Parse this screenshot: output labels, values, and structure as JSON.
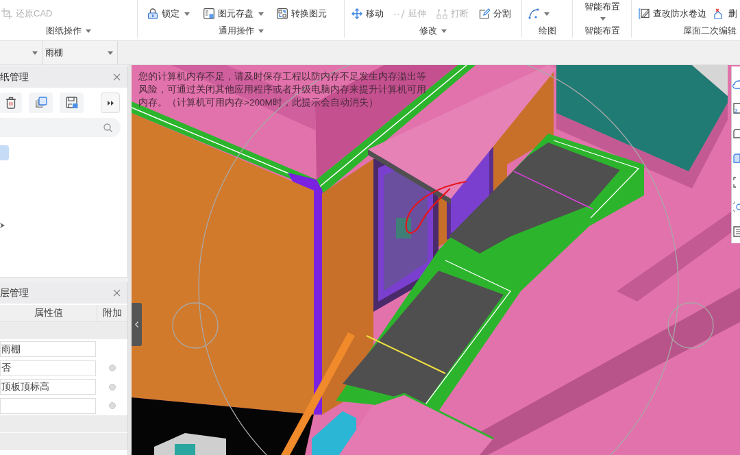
{
  "ribbon": {
    "groups": [
      {
        "label": "图纸操作",
        "menu": true,
        "buttons": [
          {
            "kind": "small",
            "label": "还原CAD",
            "disabled": true,
            "dropdown": false
          }
        ]
      },
      {
        "label": "通用操作",
        "menu": true,
        "buttons": [
          {
            "kind": "small",
            "label": "锁定",
            "disabled": false,
            "dropdown": true
          },
          {
            "kind": "small",
            "label": "图元存盘",
            "disabled": false,
            "dropdown": true
          },
          {
            "kind": "small",
            "label": "转换图元",
            "disabled": false,
            "dropdown": false
          }
        ]
      },
      {
        "label": "修改",
        "menu": true,
        "buttons": [
          {
            "kind": "small",
            "label": "移动",
            "disabled": false,
            "dropdown": false
          },
          {
            "kind": "small",
            "label": "延伸",
            "disabled": true,
            "dropdown": false
          },
          {
            "kind": "small",
            "label": "打断",
            "disabled": true,
            "dropdown": false
          },
          {
            "kind": "small",
            "label": "分割",
            "disabled": false,
            "dropdown": false
          }
        ]
      },
      {
        "label": "绘图",
        "buttons": [
          {
            "kind": "small",
            "disabled": false,
            "dropdown": true
          }
        ]
      },
      {
        "label": "智能布置",
        "buttons": [
          {
            "kind": "large",
            "label": "智能布置",
            "disabled": false,
            "dropdown": true
          }
        ]
      },
      {
        "label": "屋面二次编辑",
        "buttons": [
          {
            "kind": "small",
            "label": "查改防水卷边",
            "disabled": false,
            "dropdown": false
          },
          {
            "kind": "small",
            "label": "删",
            "disabled": false,
            "dropdown": false
          }
        ]
      }
    ]
  },
  "layer_selector": {
    "value": "雨棚"
  },
  "drawing_panel": {
    "title": "纸管理",
    "tree": [
      {
        "selected": true
      },
      {
        "selected": false,
        "expanded": false
      }
    ]
  },
  "property_panel": {
    "title": "层管理",
    "columns": [
      "属性值",
      "附加"
    ],
    "rows": [
      {
        "kind": "group"
      },
      {
        "kind": "field",
        "value": "雨棚"
      },
      {
        "kind": "field",
        "value": "否",
        "attached": false
      },
      {
        "kind": "field",
        "value": "顶板顶标高",
        "attached": false
      },
      {
        "kind": "field",
        "attached": false
      },
      {
        "kind": "group"
      },
      {
        "kind": "group"
      }
    ]
  },
  "viewport": {
    "notice": "您的计算机内存不足，请及时保存工程以防内存不足发生内存溢出等风险，可通过关闭其他应用程序或者升级电脑内存来提升计算机可用内存。（计算机可用内存>200M时，此提示会自动消失）"
  }
}
